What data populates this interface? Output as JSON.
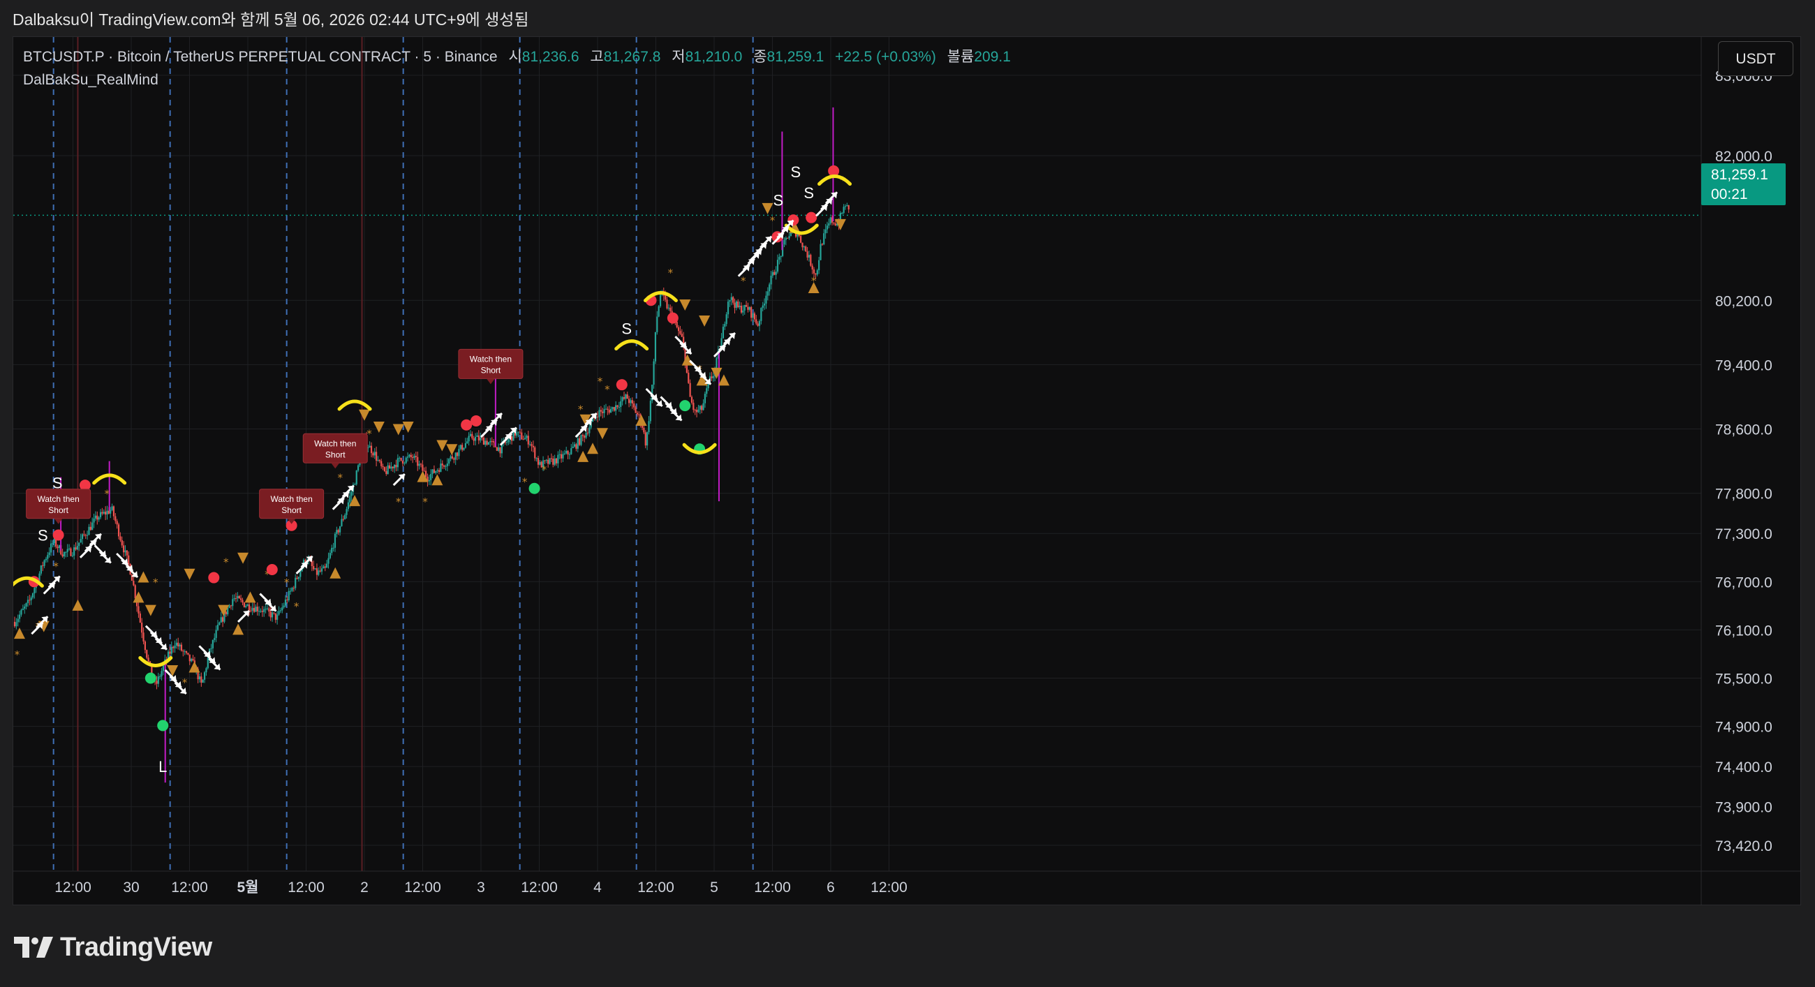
{
  "header": {
    "snapshot_line": "Dalbaksu이 TradingView.com와 함께 5월 06, 2026 02:44 UTC+9에 생성됨"
  },
  "legend": {
    "symbol": "BTCUSDT.P · Bitcoin / TetherUS PERPETUAL CONTRACT · 5 · Binance",
    "open_label": "시",
    "open": "81,236.6",
    "high_label": "고",
    "high": "81,267.8",
    "low_label": "저",
    "low": "81,210.0",
    "close_label": "종",
    "close": "81,259.1",
    "change": "+22.5 (+0.03%)",
    "volume_label": "볼륨",
    "volume": "209.1",
    "indicator": "DalBakSu_RealMind"
  },
  "toolbar": {
    "currency": "USDT"
  },
  "price_badge": {
    "price": "81,259.1",
    "countdown": "00:21"
  },
  "brand": {
    "name": "TradingView"
  },
  "colors": {
    "background": "#0e0e0f",
    "up": "#26a69a",
    "down": "#ef5350",
    "accent": "#089981",
    "signal_orange": "#c7892c",
    "signal_red": "#f23645",
    "signal_green": "#22d36e",
    "arc_yellow": "#f7e11b",
    "session_line": "#3f6fb5",
    "wick_magenta": "#c21cc6"
  },
  "chart_data": {
    "type": "candlestick",
    "title": "",
    "timeframe": "5",
    "current_price": 81259.1,
    "price_axis_ticks": [
      "83,000.0",
      "82,000.0",
      "80,200.0",
      "79,400.0",
      "78,600.0",
      "77,800.0",
      "77,300.0",
      "76,700.0",
      "76,100.0",
      "75,500.0",
      "74,900.0",
      "74,400.0",
      "73,900.0",
      "73,420.0"
    ],
    "price_tick_values": [
      83000,
      82000,
      80200,
      79400,
      78600,
      77800,
      77300,
      76700,
      76100,
      75500,
      74900,
      74400,
      73900,
      73420
    ],
    "time_axis_ticks": [
      "12:00",
      "30",
      "12:00",
      "5월",
      "12:00",
      "2",
      "12:00",
      "3",
      "12:00",
      "4",
      "12:00",
      "5",
      "12:00",
      "6",
      "12:00"
    ],
    "time_tick_bold": [
      false,
      false,
      false,
      true,
      false,
      false,
      false,
      false,
      false,
      false,
      false,
      false,
      false,
      false,
      false
    ],
    "time_tick_hours": [
      12,
      24,
      36,
      48,
      60,
      72,
      84,
      96,
      108,
      120,
      132,
      144,
      156,
      168,
      180
    ],
    "session_line_hours": [
      8,
      32,
      56,
      80,
      104,
      128,
      152
    ],
    "red_session_hours": [
      13,
      71.5
    ],
    "price_path": [
      {
        "h": 0,
        "p": 76200
      },
      {
        "h": 3,
        "p": 76450
      },
      {
        "h": 6,
        "p": 76950
      },
      {
        "h": 8,
        "p": 77200
      },
      {
        "h": 10,
        "p": 77050
      },
      {
        "h": 12,
        "p": 77080
      },
      {
        "h": 14,
        "p": 77250
      },
      {
        "h": 17,
        "p": 77500
      },
      {
        "h": 20,
        "p": 77600
      },
      {
        "h": 22,
        "p": 77200
      },
      {
        "h": 24,
        "p": 76800
      },
      {
        "h": 26,
        "p": 76150
      },
      {
        "h": 27.5,
        "p": 75700
      },
      {
        "h": 29,
        "p": 75400
      },
      {
        "h": 31,
        "p": 75700
      },
      {
        "h": 33,
        "p": 75950
      },
      {
        "h": 35,
        "p": 75800
      },
      {
        "h": 37,
        "p": 75650
      },
      {
        "h": 38.5,
        "p": 75400
      },
      {
        "h": 40,
        "p": 75800
      },
      {
        "h": 42,
        "p": 76150
      },
      {
        "h": 45,
        "p": 76500
      },
      {
        "h": 48,
        "p": 76400
      },
      {
        "h": 51,
        "p": 76350
      },
      {
        "h": 54,
        "p": 76250
      },
      {
        "h": 57,
        "p": 76600
      },
      {
        "h": 60,
        "p": 77000
      },
      {
        "h": 62,
        "p": 76800
      },
      {
        "h": 64,
        "p": 76850
      },
      {
        "h": 66,
        "p": 77250
      },
      {
        "h": 68,
        "p": 77550
      },
      {
        "h": 70,
        "p": 77950
      },
      {
        "h": 72,
        "p": 78450
      },
      {
        "h": 74,
        "p": 78300
      },
      {
        "h": 76,
        "p": 78050
      },
      {
        "h": 79,
        "p": 78200
      },
      {
        "h": 82,
        "p": 78250
      },
      {
        "h": 85,
        "p": 78000
      },
      {
        "h": 88,
        "p": 78150
      },
      {
        "h": 91,
        "p": 78300
      },
      {
        "h": 94,
        "p": 78500
      },
      {
        "h": 97,
        "p": 78450
      },
      {
        "h": 100,
        "p": 78350
      },
      {
        "h": 103,
        "p": 78550
      },
      {
        "h": 106,
        "p": 78450
      },
      {
        "h": 108,
        "p": 78150
      },
      {
        "h": 111,
        "p": 78200
      },
      {
        "h": 114,
        "p": 78300
      },
      {
        "h": 117,
        "p": 78500
      },
      {
        "h": 120,
        "p": 78800
      },
      {
        "h": 123,
        "p": 78850
      },
      {
        "h": 126,
        "p": 79000
      },
      {
        "h": 129,
        "p": 78700
      },
      {
        "h": 130,
        "p": 78400
      },
      {
        "h": 131.5,
        "p": 79300
      },
      {
        "h": 132,
        "p": 79900
      },
      {
        "h": 133,
        "p": 80300
      },
      {
        "h": 134.5,
        "p": 80100
      },
      {
        "h": 136,
        "p": 79900
      },
      {
        "h": 137.5,
        "p": 79700
      },
      {
        "h": 139,
        "p": 79000
      },
      {
        "h": 140,
        "p": 78800
      },
      {
        "h": 141.5,
        "p": 78850
      },
      {
        "h": 143,
        "p": 79200
      },
      {
        "h": 144,
        "p": 79300
      },
      {
        "h": 145.5,
        "p": 79700
      },
      {
        "h": 147,
        "p": 80250
      },
      {
        "h": 149,
        "p": 80100
      },
      {
        "h": 151,
        "p": 80100
      },
      {
        "h": 153,
        "p": 79900
      },
      {
        "h": 155,
        "p": 80350
      },
      {
        "h": 157,
        "p": 80650
      },
      {
        "h": 159,
        "p": 81000
      },
      {
        "h": 161,
        "p": 81050
      },
      {
        "h": 163,
        "p": 80800
      },
      {
        "h": 165,
        "p": 80500
      },
      {
        "h": 166,
        "p": 80900
      },
      {
        "h": 168,
        "p": 81200
      },
      {
        "h": 169.5,
        "p": 81150
      },
      {
        "h": 171,
        "p": 81400
      },
      {
        "h": 172,
        "p": 81259
      }
    ],
    "wick_spikes": [
      {
        "h": 9.5,
        "p_high": 78000
      },
      {
        "h": 19.5,
        "p_high": 78200
      },
      {
        "h": 31,
        "p_low": 74200
      },
      {
        "h": 99,
        "p_high": 79500
      },
      {
        "h": 145,
        "p_low": 77700
      },
      {
        "h": 158,
        "p_high": 82300
      },
      {
        "h": 168.5,
        "p_high": 82600
      }
    ],
    "labels": [
      {
        "text": "Watch then Short",
        "kind": "box",
        "h": 9,
        "p": 77660
      },
      {
        "text": "Watch then Short",
        "kind": "box",
        "h": 57,
        "p": 77660
      },
      {
        "text": "Watch then Short",
        "kind": "box",
        "h": 66,
        "p": 78350
      },
      {
        "text": "Watch then Short",
        "kind": "box",
        "h": 98,
        "p": 79400
      },
      {
        "text": "S",
        "kind": "text",
        "h": 8.8,
        "p": 77930
      },
      {
        "text": "S",
        "kind": "text",
        "h": 5.8,
        "p": 77280
      },
      {
        "text": "L",
        "kind": "text",
        "h": 30.5,
        "p": 74400
      },
      {
        "text": "S",
        "kind": "text",
        "h": 126,
        "p": 79850
      },
      {
        "text": "S",
        "kind": "text",
        "h": 157.2,
        "p": 81450
      },
      {
        "text": "S",
        "kind": "text",
        "h": 160.8,
        "p": 81800
      },
      {
        "text": "S",
        "kind": "text",
        "h": 163.5,
        "p": 81540
      }
    ],
    "red_dots": [
      [
        4,
        76700
      ],
      [
        9,
        77280
      ],
      [
        14.5,
        77900
      ],
      [
        41,
        76750
      ],
      [
        53,
        76850
      ],
      [
        57,
        77400
      ],
      [
        93,
        78650
      ],
      [
        95,
        78700
      ],
      [
        125,
        79150
      ],
      [
        131,
        80200
      ],
      [
        135.5,
        79980
      ],
      [
        157,
        80990
      ],
      [
        160.3,
        81200
      ],
      [
        164,
        81230
      ],
      [
        168.6,
        81810
      ]
    ],
    "green_dots": [
      [
        28,
        75500
      ],
      [
        30.5,
        74910
      ],
      [
        107,
        77860
      ],
      [
        138,
        78890
      ],
      [
        141,
        78350
      ]
    ],
    "orange_triangles_up": [
      [
        1,
        76050
      ],
      [
        13,
        76400
      ],
      [
        25.5,
        76500
      ],
      [
        26.5,
        76750
      ],
      [
        37,
        75630
      ],
      [
        46,
        76100
      ],
      [
        48.5,
        76500
      ],
      [
        66,
        76800
      ],
      [
        70,
        77700
      ],
      [
        84,
        78000
      ],
      [
        87,
        77960
      ],
      [
        117,
        78250
      ],
      [
        119,
        78350
      ],
      [
        138.5,
        79450
      ],
      [
        141.5,
        79200
      ],
      [
        146,
        79200
      ],
      [
        160.6,
        81100
      ],
      [
        164.5,
        80350
      ],
      [
        129,
        78700
      ]
    ],
    "orange_triangles_down": [
      [
        6,
        76150
      ],
      [
        28,
        76350
      ],
      [
        32.5,
        75600
      ],
      [
        36,
        76800
      ],
      [
        43,
        76350
      ],
      [
        47,
        77000
      ],
      [
        72,
        78780
      ],
      [
        75,
        78630
      ],
      [
        79,
        78600
      ],
      [
        81,
        78630
      ],
      [
        88,
        78400
      ],
      [
        90,
        78350
      ],
      [
        117.5,
        78720
      ],
      [
        121,
        78550
      ],
      [
        138,
        80150
      ],
      [
        142,
        79950
      ],
      [
        144.5,
        79300
      ],
      [
        155,
        81350
      ],
      [
        170,
        81150
      ]
    ],
    "orange_stars": [
      [
        0.5,
        75800
      ],
      [
        4.8,
        76150
      ],
      [
        8.5,
        76900
      ],
      [
        13.8,
        77600
      ],
      [
        19,
        77800
      ],
      [
        29,
        76700
      ],
      [
        35,
        75450
      ],
      [
        43.5,
        76950
      ],
      [
        52,
        76800
      ],
      [
        56,
        76700
      ],
      [
        58,
        76400
      ],
      [
        67,
        78000
      ],
      [
        73,
        78550
      ],
      [
        79,
        77700
      ],
      [
        84.5,
        77700
      ],
      [
        87,
        77950
      ],
      [
        105,
        77950
      ],
      [
        109,
        78100
      ],
      [
        116.5,
        78850
      ],
      [
        120.5,
        79200
      ],
      [
        122,
        79100
      ],
      [
        135,
        80550
      ],
      [
        141,
        79350
      ],
      [
        150,
        80450
      ],
      [
        156,
        81200
      ],
      [
        164.5,
        80450
      ],
      [
        170.5,
        81700
      ]
    ],
    "yellow_arcs": [
      [
        2.5,
        76700,
        "cap"
      ],
      [
        9,
        77580,
        "cap"
      ],
      [
        19.5,
        77980,
        "cap"
      ],
      [
        29,
        75700,
        "cup"
      ],
      [
        70,
        78900,
        "cap"
      ],
      [
        127,
        79650,
        "cap"
      ],
      [
        133,
        80250,
        "cap"
      ],
      [
        141,
        78350,
        "cup"
      ],
      [
        162,
        81080,
        "cup"
      ],
      [
        168.8,
        81700,
        "cap"
      ]
    ],
    "white_arrow_clusters": [
      [
        3.5,
        76050,
        "up",
        2
      ],
      [
        6,
        76550,
        "up",
        2
      ],
      [
        13.5,
        77000,
        "up",
        3
      ],
      [
        16.5,
        77150,
        "down",
        2
      ],
      [
        21,
        77050,
        "down",
        3
      ],
      [
        27,
        76150,
        "down",
        3
      ],
      [
        31,
        75600,
        "down",
        3
      ],
      [
        38,
        75900,
        "down",
        3
      ],
      [
        46,
        76200,
        "up",
        1
      ],
      [
        50.5,
        76550,
        "down",
        2
      ],
      [
        58,
        76800,
        "up",
        2
      ],
      [
        65.5,
        77600,
        "up",
        3
      ],
      [
        78,
        77900,
        "up",
        1
      ],
      [
        96,
        78500,
        "up",
        3
      ],
      [
        100,
        78400,
        "up",
        2
      ],
      [
        115.5,
        78500,
        "up",
        3
      ],
      [
        130,
        79100,
        "down",
        2
      ],
      [
        133,
        79000,
        "down",
        3
      ],
      [
        136,
        79750,
        "down",
        2
      ],
      [
        139,
        79450,
        "down",
        3
      ],
      [
        144,
        79500,
        "up",
        3
      ],
      [
        149,
        80500,
        "up",
        3
      ],
      [
        151.5,
        80700,
        "up",
        3
      ],
      [
        156,
        80900,
        "up",
        3
      ],
      [
        165,
        81250,
        "up",
        3
      ]
    ]
  }
}
